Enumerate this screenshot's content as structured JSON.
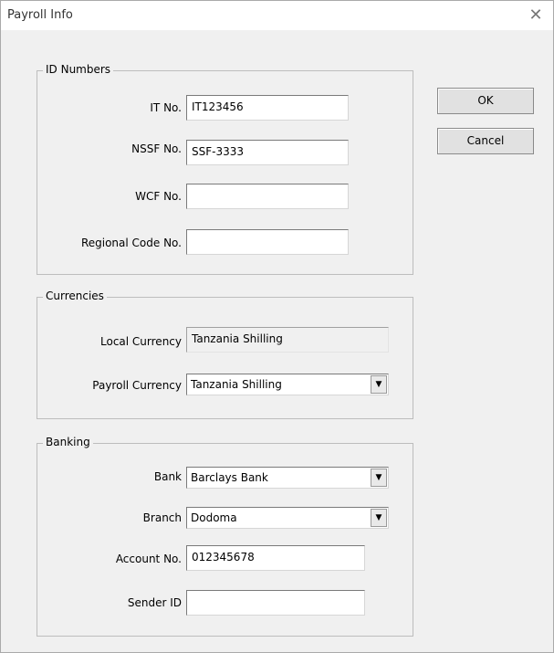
{
  "window": {
    "title": "Payroll Info",
    "close_glyph": "✕"
  },
  "buttons": {
    "ok": "OK",
    "cancel": "Cancel"
  },
  "id_numbers": {
    "legend": "ID Numbers",
    "it_label": "IT No.",
    "it_value": "IT123456",
    "nssf_label": "NSSF No.",
    "nssf_value": "SSF-3333",
    "wcf_label": "WCF No.",
    "wcf_value": "",
    "regional_label": "Regional Code No.",
    "regional_value": ""
  },
  "currencies": {
    "legend": "Currencies",
    "local_label": "Local Currency",
    "local_value": "Tanzania Shilling",
    "payroll_label": "Payroll Currency",
    "payroll_value": "Tanzania Shilling"
  },
  "banking": {
    "legend": "Banking",
    "bank_label": "Bank",
    "bank_value": "Barclays Bank",
    "branch_label": "Branch",
    "branch_value": "Dodoma",
    "account_label": "Account No.",
    "account_value": "012345678",
    "sender_label": "Sender ID",
    "sender_value": ""
  },
  "icons": {
    "dropdown": "▼"
  }
}
